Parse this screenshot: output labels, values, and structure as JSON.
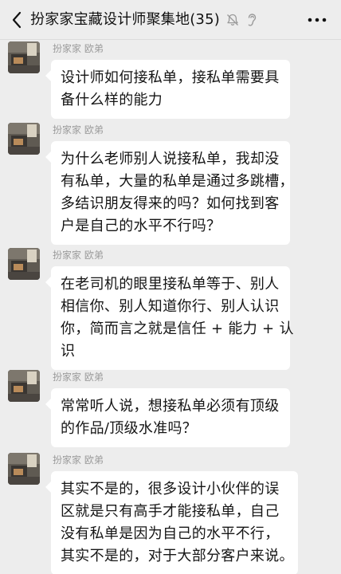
{
  "header": {
    "title": "扮家家宝藏设计师聚集地(35)"
  },
  "colors": {
    "background": "#ededed",
    "bubble": "#ffffff",
    "sender_text": "#9b9b9b"
  },
  "icons": [
    "back-arrow-icon",
    "mute-bell-icon",
    "earpiece-icon",
    "more-dots-icon",
    "avatar"
  ],
  "messages": [
    {
      "sender": "扮家家 欧弟",
      "lines": [
        "设计师如何接私单，接私单需要具",
        "备什么样的能力"
      ]
    },
    {
      "sender": "扮家家 欧弟",
      "lines": [
        "为什么老师别人说接私单，我却没",
        "有私单，大量的私单是通过多跳槽，",
        "多结识朋友得来的吗？如何找到客",
        "户是自己的水平不行吗？"
      ]
    },
    {
      "sender": "扮家家 欧弟",
      "lines": [
        "在老司机的眼里接私单等于、别人",
        "相信你、别人知道你行、别人认识",
        "你，简而言之就是信任 + 能力 + 认",
        "识"
      ]
    },
    {
      "sender": "扮家家 欧弟",
      "lines": [
        "常常听人说，想接私单必须有顶级",
        "的作品/顶级水准吗？"
      ]
    },
    {
      "sender": "扮家家 欧弟",
      "lines": [
        "其实不是的，很多设计小伙伴的误",
        "区就是只有高手才能接私单，自己",
        "没有私单是因为自己的水平不行，",
        "其实不是的，对于大部分客户来说。"
      ]
    }
  ]
}
